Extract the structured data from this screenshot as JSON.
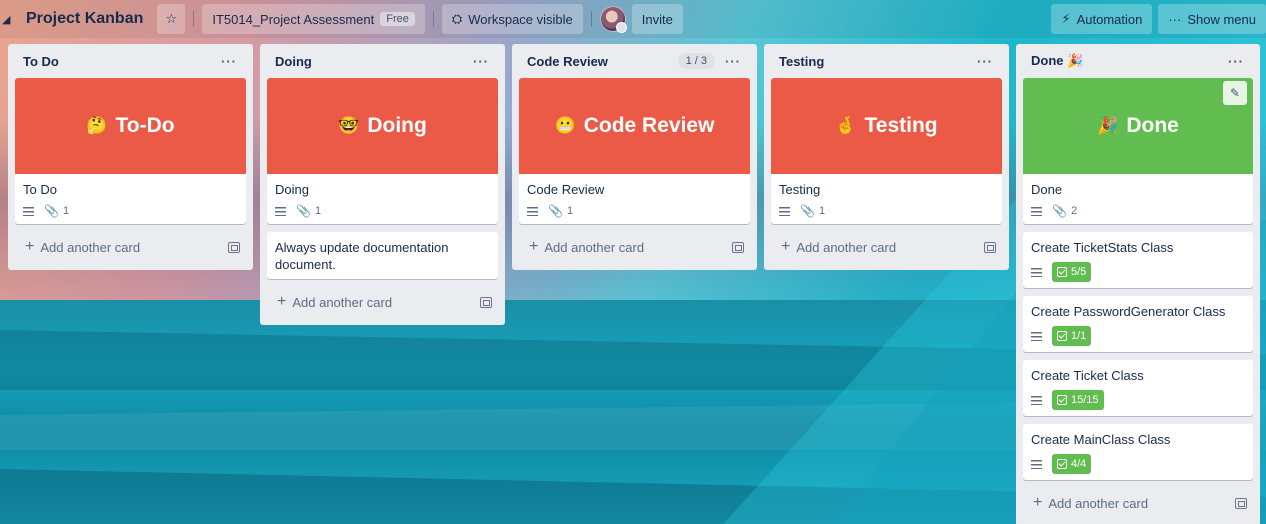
{
  "header": {
    "board_title": "Project Kanban",
    "workspace": "IT5014_Project Assessment",
    "free_badge": "Free",
    "visibility": "Workspace visible",
    "invite": "Invite",
    "automation": "Automation",
    "show_menu": "Show menu"
  },
  "lists": [
    {
      "title": "To Do",
      "cards": [
        {
          "cover_text": "To-Do",
          "cover_emoji": "🤔",
          "cover_color": "#eb5a46",
          "title": "To Do",
          "attachments": "1"
        }
      ],
      "add_label": "Add another card"
    },
    {
      "title": "Doing",
      "cards": [
        {
          "cover_text": "Doing",
          "cover_emoji": "🤓",
          "cover_color": "#eb5a46",
          "title": "Doing",
          "attachments": "1"
        },
        {
          "title": "Always update documentation document."
        }
      ],
      "add_label": "Add another card"
    },
    {
      "title": "Code Review",
      "limit": "1 / 3",
      "cards": [
        {
          "cover_text": "Code Review",
          "cover_emoji": "😬",
          "cover_color": "#eb5a46",
          "title": "Code Review",
          "attachments": "1"
        }
      ],
      "add_label": "Add another card"
    },
    {
      "title": "Testing",
      "cards": [
        {
          "cover_text": "Testing",
          "cover_emoji": "🤞",
          "cover_color": "#eb5a46",
          "title": "Testing",
          "attachments": "1"
        }
      ],
      "add_label": "Add another card"
    },
    {
      "title": "Done 🎉",
      "cards": [
        {
          "cover_text": "Done",
          "cover_emoji": "🎉",
          "cover_color": "#61bd4f",
          "title": "Done",
          "attachments": "2"
        },
        {
          "title": "Create TicketStats Class",
          "checklist": "5/5"
        },
        {
          "title": "Create PasswordGenerator Class",
          "checklist": "1/1"
        },
        {
          "title": "Create Ticket Class",
          "checklist": "15/15"
        },
        {
          "title": "Create MainClass Class",
          "checklist": "4/4"
        }
      ],
      "add_label": "Add another card"
    }
  ]
}
